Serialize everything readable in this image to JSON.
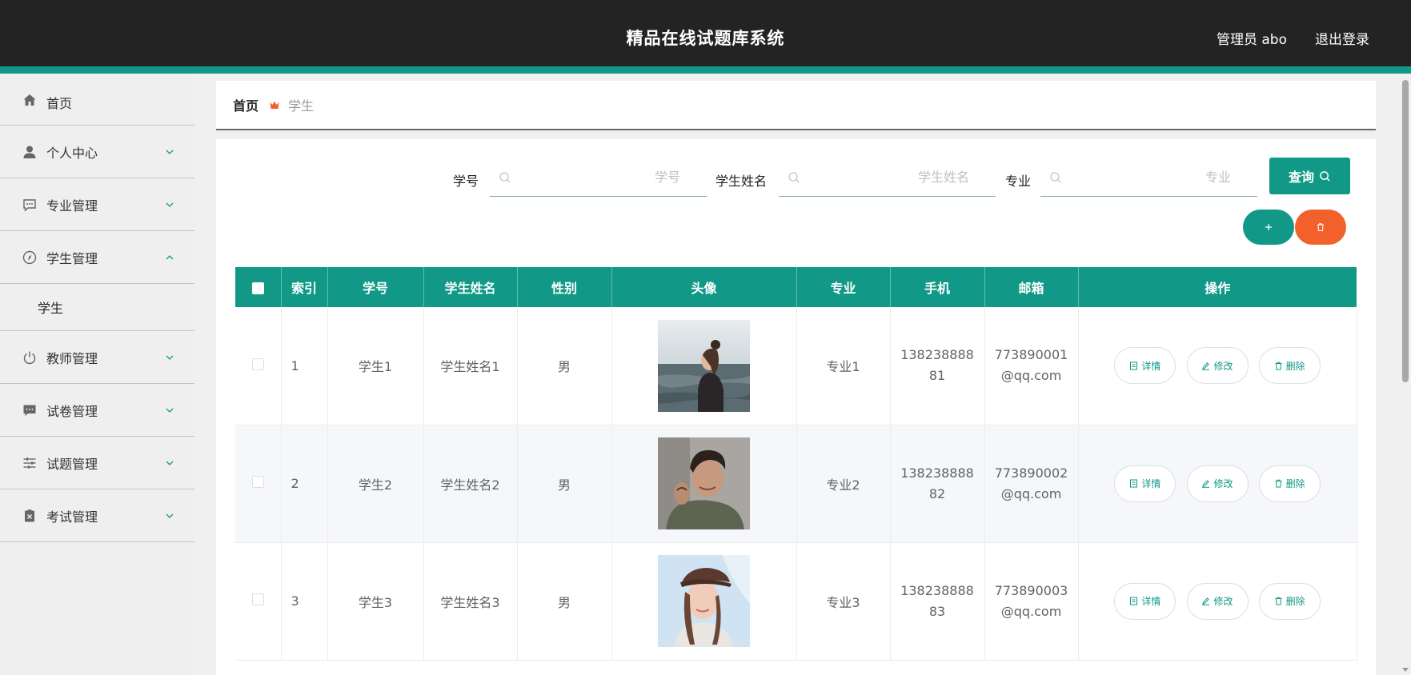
{
  "header": {
    "title": "精品在线试题库系统",
    "user": "管理员 abo",
    "logout": "退出登录"
  },
  "sidebar": {
    "items": [
      {
        "label": "首页",
        "icon": "home-icon"
      },
      {
        "label": "个人中心",
        "icon": "user-icon"
      },
      {
        "label": "专业管理",
        "icon": "message-icon"
      },
      {
        "label": "学生管理",
        "icon": "compass-icon"
      },
      {
        "label": "教师管理",
        "icon": "power-icon"
      },
      {
        "label": "试卷管理",
        "icon": "chat-icon"
      },
      {
        "label": "试题管理",
        "icon": "sliders-icon"
      },
      {
        "label": "考试管理",
        "icon": "clipboard-icon"
      }
    ],
    "sub_item": "学生"
  },
  "breadcrumb": {
    "home": "首页",
    "current": "学生"
  },
  "search": {
    "fields": [
      {
        "label": "学号",
        "placeholder": "学号"
      },
      {
        "label": "学生姓名",
        "placeholder": "学生姓名"
      },
      {
        "label": "专业",
        "placeholder": "专业"
      }
    ],
    "query_label": "查询"
  },
  "table": {
    "columns": [
      "索引",
      "学号",
      "学生姓名",
      "性别",
      "头像",
      "专业",
      "手机",
      "邮箱",
      "操作"
    ],
    "rows": [
      {
        "index": "1",
        "id": "学生1",
        "name": "学生姓名1",
        "gender": "男",
        "major": "专业1",
        "phone": "13823888881",
        "email": "773890001@qq.com"
      },
      {
        "index": "2",
        "id": "学生2",
        "name": "学生姓名2",
        "gender": "男",
        "major": "专业2",
        "phone": "13823888882",
        "email": "773890002@qq.com"
      },
      {
        "index": "3",
        "id": "学生3",
        "name": "学生姓名3",
        "gender": "男",
        "major": "专业3",
        "phone": "13823888883",
        "email": "773890003@qq.com"
      }
    ],
    "actions": {
      "detail": "详情",
      "edit": "修改",
      "delete": "删除"
    }
  },
  "colors": {
    "accent": "#119886",
    "danger": "#f2612c",
    "header_bg": "#232323"
  }
}
